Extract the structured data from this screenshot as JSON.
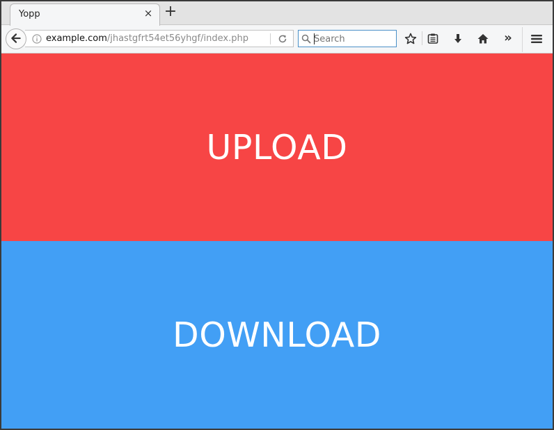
{
  "browser": {
    "tab": {
      "title": "Yopp",
      "close_glyph": "×"
    },
    "new_tab_glyph": "+",
    "url": {
      "domain": "example.com",
      "path": "/jhastgfrt54et56yhgf/index.php"
    },
    "search": {
      "placeholder": "Search"
    },
    "toolbar_icons": [
      "back-icon",
      "info-icon",
      "reload-icon",
      "search-icon",
      "star-icon",
      "reading-list-icon",
      "download-icon",
      "home-icon",
      "overflow-icon",
      "menu-icon"
    ],
    "overflow_glyph": "»"
  },
  "page": {
    "upload_label": "UPLOAD",
    "download_label": "DOWNLOAD"
  },
  "colors": {
    "upload": "#f74545",
    "download": "#429ff5",
    "text": "#ffffff"
  }
}
